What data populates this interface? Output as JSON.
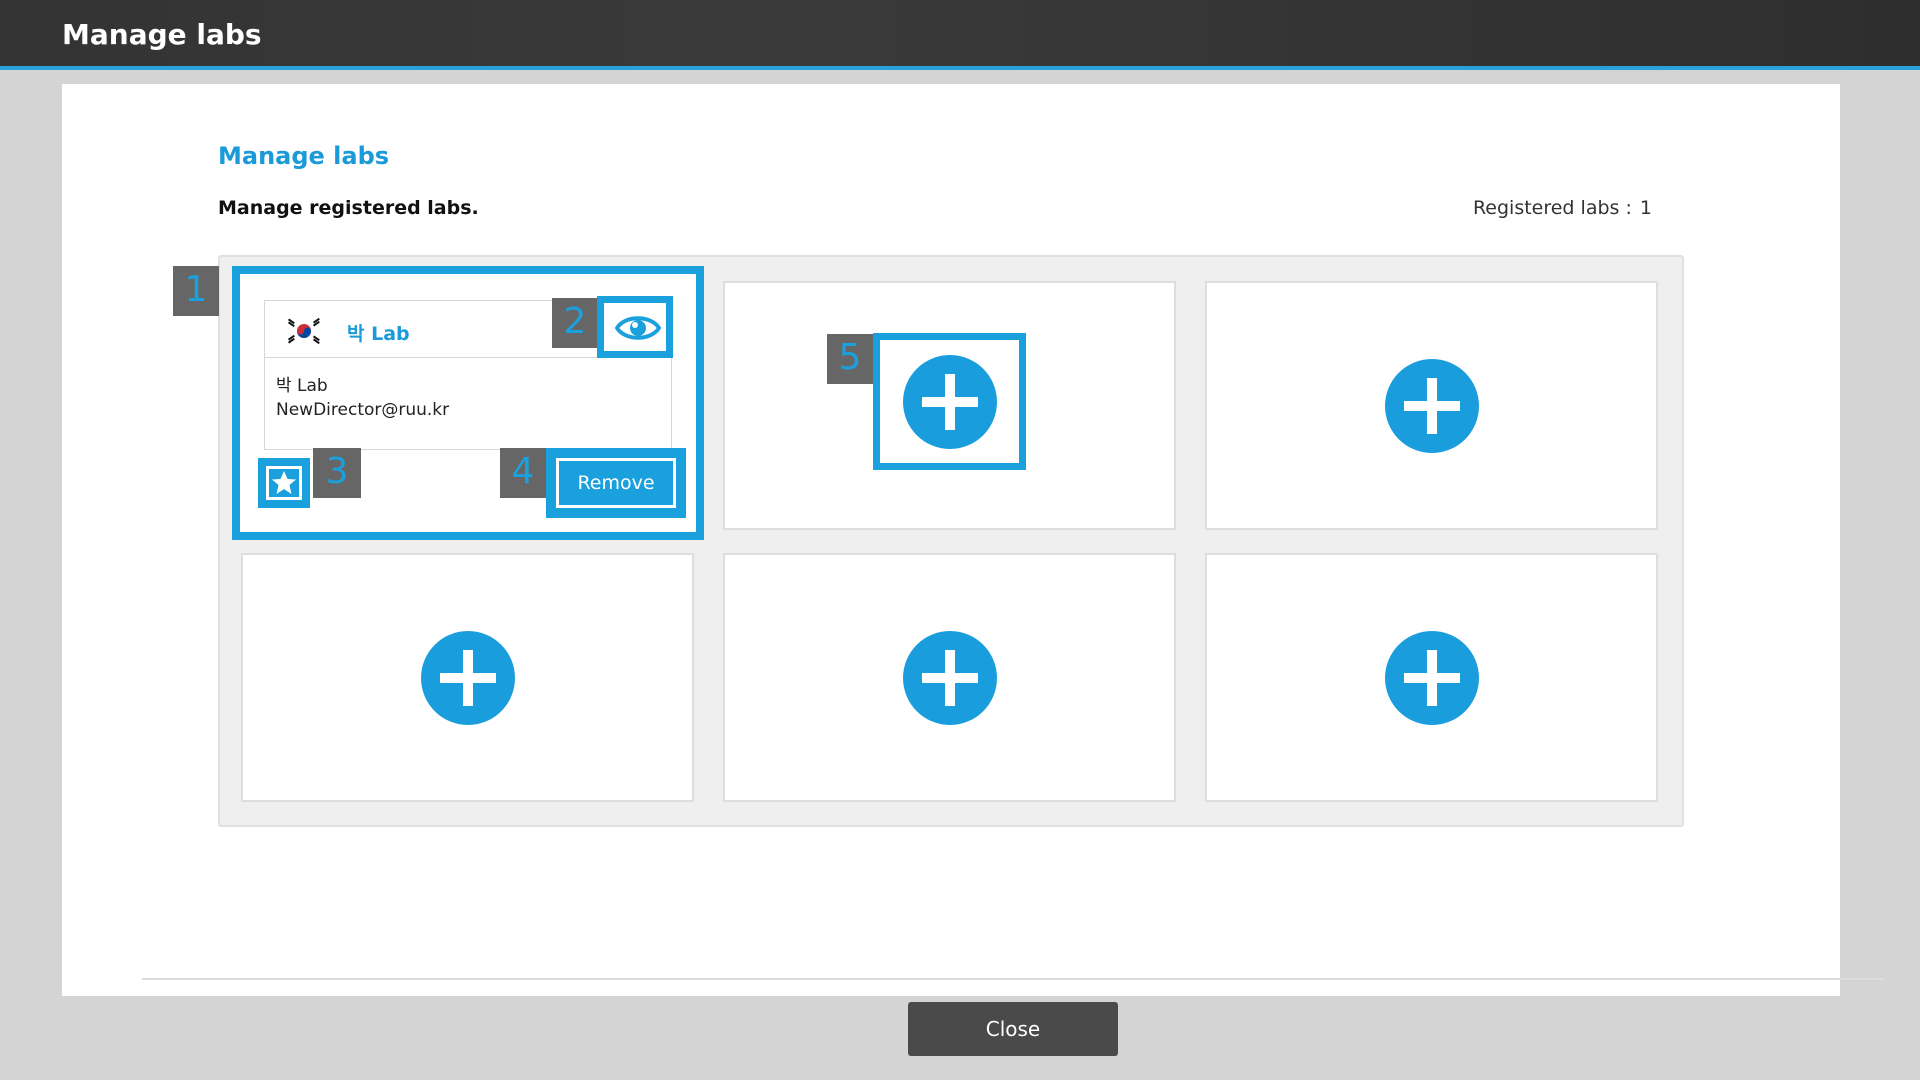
{
  "window": {
    "title": "Manage labs"
  },
  "section": {
    "heading": "Manage labs",
    "description": "Manage registered labs.",
    "count_label": "Registered labs :",
    "count_value": "1"
  },
  "lab_card": {
    "name": "박 Lab",
    "body_name": "박 Lab",
    "email": "NewDirector@ruu.kr",
    "remove_label": "Remove",
    "flag_icon": "korea-flag-icon",
    "view_icon": "eye-icon",
    "favorite_icon": "star-icon"
  },
  "empty_slots": 5,
  "callouts": [
    "1",
    "2",
    "3",
    "4",
    "5"
  ],
  "footer": {
    "close_label": "Close"
  },
  "colors": {
    "accent": "#1ba0de",
    "titlebar": "#333333",
    "callout_bg": "#666666"
  }
}
